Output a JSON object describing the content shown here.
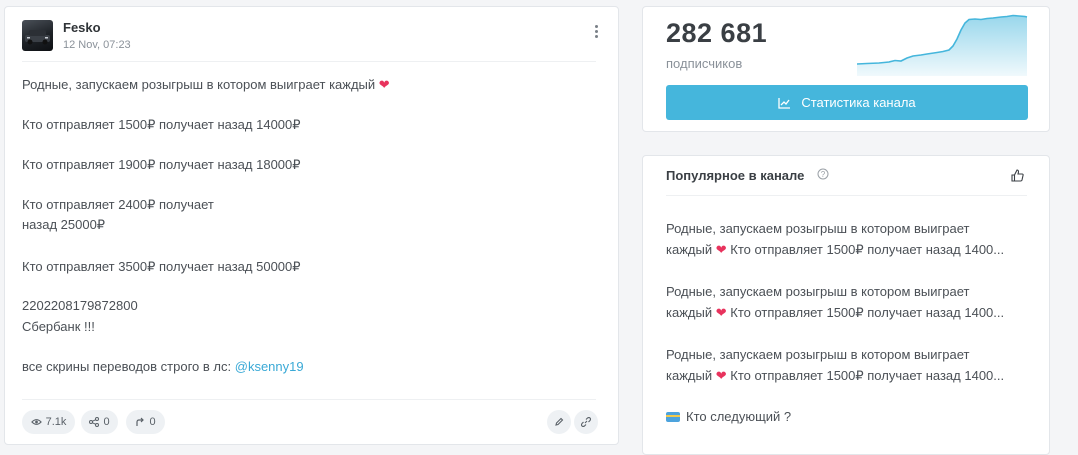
{
  "post": {
    "author": "Fesko",
    "date": "12 Nov, 07:23",
    "lines": {
      "l1": "Родные, запускаем розыгрыш в котором выиграет каждый",
      "l2": "Кто отправляет 1500₽ получает назад 14000₽",
      "l3": "Кто отправляет 1900₽ получает назад 18000₽",
      "l4a": "Кто отправляет 2400₽ получает",
      "l4b": "назад 25000₽",
      "l5": "Кто отправляет 3500₽ получает назад 50000₽",
      "l6a": "2202208179872800",
      "l6b": "Сбербанк !!!",
      "l7": "все скрины переводов строго в лс:",
      "l7_link": "@ksenny19"
    },
    "footer": {
      "views": "7.1k",
      "shares": "0",
      "forwards": "0"
    },
    "icons": [
      "heart-emoji",
      "menu-dots-icon",
      "eye-icon",
      "share-icon",
      "forward-icon",
      "edit-icon",
      "link-icon"
    ]
  },
  "stats": {
    "subscribers": "282 681",
    "subscribers_label": "подписчиков",
    "button_label": "Статистика канала",
    "chart_color": "#45b6dc",
    "accent": "#45b6dc"
  },
  "popular": {
    "title": "Популярное в канале",
    "items": [
      {
        "line1": "Родные, запускаем розыгрыш в котором выиграет",
        "line2": "каждый",
        "line2_rest": "Кто отправляет 1500₽ получает назад 1400..."
      },
      {
        "line1": "Родные, запускаем розыгрыш в котором выиграет",
        "line2": "каждый",
        "line2_rest": "Кто отправляет 1500₽ получает назад 1400..."
      },
      {
        "line1": "Родные, запускаем розыгрыш в котором выиграет",
        "line2": "каждый",
        "line2_rest": "Кто отправляет 1500₽ получает назад 1400..."
      },
      {
        "line1": "Кто следующий ?"
      }
    ]
  }
}
